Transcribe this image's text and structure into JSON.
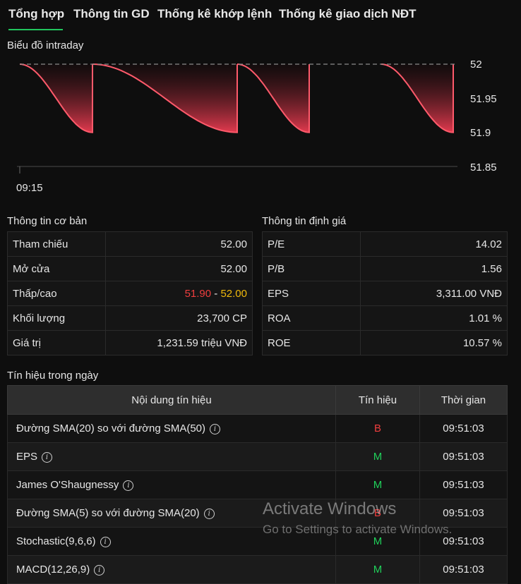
{
  "tabs": [
    "Tổng hợp",
    "Thông tin GD",
    "Thống kê khớp lệnh",
    "Thống kê giao dịch NĐT"
  ],
  "active_tab": 0,
  "chart_section_title": "Biểu đồ intraday",
  "chart_data": {
    "type": "area",
    "title": "",
    "x_ticks": [
      "09:15"
    ],
    "y_ticks": [
      "52",
      "51.95",
      "51.9",
      "51.85"
    ],
    "ylim": [
      51.85,
      52
    ],
    "reference_price": 52,
    "segments": [
      {
        "from": 52,
        "to": 51.9
      },
      {
        "from": 52,
        "to": 51.9
      },
      {
        "from": 52,
        "to": 51.9
      },
      {
        "from": 52,
        "to": 51.9
      }
    ],
    "colors": {
      "line": "#ff5a6b",
      "fill": "#e23a4e"
    }
  },
  "basic_info": {
    "title": "Thông tin cơ bản",
    "rows": [
      {
        "label": "Tham chiếu",
        "value": "52.00"
      },
      {
        "label": "Mở cửa",
        "value": "52.00"
      },
      {
        "label": "Thấp/cao",
        "low": "51.90",
        "sep": " - ",
        "high": "52.00"
      },
      {
        "label": "Khối lượng",
        "value": "23,700 CP"
      },
      {
        "label": "Giá trị",
        "value": "1,231.59 triệu VNĐ"
      }
    ]
  },
  "valuation_info": {
    "title": "Thông tin định giá",
    "rows": [
      {
        "label": "P/E",
        "value": "14.02"
      },
      {
        "label": "P/B",
        "value": "1.56"
      },
      {
        "label": "EPS",
        "value": "3,311.00 VNĐ"
      },
      {
        "label": "ROA",
        "value": "1.01 %"
      },
      {
        "label": "ROE",
        "value": "10.57 %"
      }
    ]
  },
  "signals": {
    "title": "Tín hiệu trong ngày",
    "headers": [
      "Nội dung tín hiệu",
      "Tín hiệu",
      "Thời gian"
    ],
    "rows": [
      {
        "content": "Đường SMA(20) so với đường SMA(50)",
        "signal": "B",
        "time": "09:51:03"
      },
      {
        "content": "EPS",
        "signal": "M",
        "time": "09:51:03"
      },
      {
        "content": "James O'Shaugnessy",
        "signal": "M",
        "time": "09:51:03"
      },
      {
        "content": "Đường SMA(5) so với đường SMA(20)",
        "signal": "B",
        "time": "09:51:03"
      },
      {
        "content": "Stochastic(9,6,6)",
        "signal": "M",
        "time": "09:51:03"
      },
      {
        "content": "MACD(12,26,9)",
        "signal": "M",
        "time": "09:51:03"
      }
    ]
  },
  "watermark": {
    "title": "Activate Windows",
    "subtitle": "Go to Settings to activate Windows."
  },
  "colors": {
    "accent": "#21c55d",
    "up": "#20d05a",
    "down": "#ef3e3e",
    "ref": "#f0b90b",
    "background": "#0e0e0e"
  }
}
